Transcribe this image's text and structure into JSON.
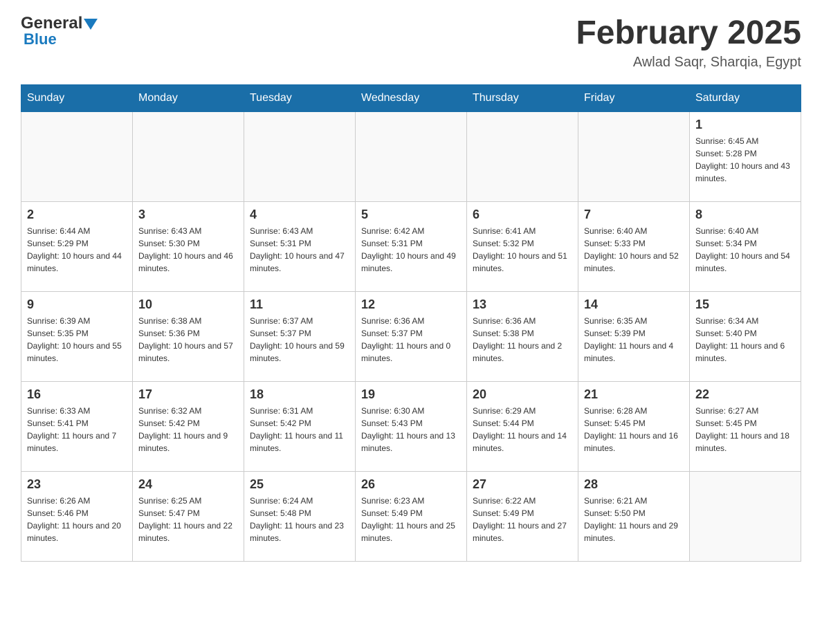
{
  "header": {
    "logo": {
      "general": "General",
      "blue": "Blue"
    },
    "title": "February 2025",
    "location": "Awlad Saqr, Sharqia, Egypt"
  },
  "weekdays": [
    "Sunday",
    "Monday",
    "Tuesday",
    "Wednesday",
    "Thursday",
    "Friday",
    "Saturday"
  ],
  "weeks": [
    [
      {
        "day": "",
        "sunrise": "",
        "sunset": "",
        "daylight": ""
      },
      {
        "day": "",
        "sunrise": "",
        "sunset": "",
        "daylight": ""
      },
      {
        "day": "",
        "sunrise": "",
        "sunset": "",
        "daylight": ""
      },
      {
        "day": "",
        "sunrise": "",
        "sunset": "",
        "daylight": ""
      },
      {
        "day": "",
        "sunrise": "",
        "sunset": "",
        "daylight": ""
      },
      {
        "day": "",
        "sunrise": "",
        "sunset": "",
        "daylight": ""
      },
      {
        "day": "1",
        "sunrise": "Sunrise: 6:45 AM",
        "sunset": "Sunset: 5:28 PM",
        "daylight": "Daylight: 10 hours and 43 minutes."
      }
    ],
    [
      {
        "day": "2",
        "sunrise": "Sunrise: 6:44 AM",
        "sunset": "Sunset: 5:29 PM",
        "daylight": "Daylight: 10 hours and 44 minutes."
      },
      {
        "day": "3",
        "sunrise": "Sunrise: 6:43 AM",
        "sunset": "Sunset: 5:30 PM",
        "daylight": "Daylight: 10 hours and 46 minutes."
      },
      {
        "day": "4",
        "sunrise": "Sunrise: 6:43 AM",
        "sunset": "Sunset: 5:31 PM",
        "daylight": "Daylight: 10 hours and 47 minutes."
      },
      {
        "day": "5",
        "sunrise": "Sunrise: 6:42 AM",
        "sunset": "Sunset: 5:31 PM",
        "daylight": "Daylight: 10 hours and 49 minutes."
      },
      {
        "day": "6",
        "sunrise": "Sunrise: 6:41 AM",
        "sunset": "Sunset: 5:32 PM",
        "daylight": "Daylight: 10 hours and 51 minutes."
      },
      {
        "day": "7",
        "sunrise": "Sunrise: 6:40 AM",
        "sunset": "Sunset: 5:33 PM",
        "daylight": "Daylight: 10 hours and 52 minutes."
      },
      {
        "day": "8",
        "sunrise": "Sunrise: 6:40 AM",
        "sunset": "Sunset: 5:34 PM",
        "daylight": "Daylight: 10 hours and 54 minutes."
      }
    ],
    [
      {
        "day": "9",
        "sunrise": "Sunrise: 6:39 AM",
        "sunset": "Sunset: 5:35 PM",
        "daylight": "Daylight: 10 hours and 55 minutes."
      },
      {
        "day": "10",
        "sunrise": "Sunrise: 6:38 AM",
        "sunset": "Sunset: 5:36 PM",
        "daylight": "Daylight: 10 hours and 57 minutes."
      },
      {
        "day": "11",
        "sunrise": "Sunrise: 6:37 AM",
        "sunset": "Sunset: 5:37 PM",
        "daylight": "Daylight: 10 hours and 59 minutes."
      },
      {
        "day": "12",
        "sunrise": "Sunrise: 6:36 AM",
        "sunset": "Sunset: 5:37 PM",
        "daylight": "Daylight: 11 hours and 0 minutes."
      },
      {
        "day": "13",
        "sunrise": "Sunrise: 6:36 AM",
        "sunset": "Sunset: 5:38 PM",
        "daylight": "Daylight: 11 hours and 2 minutes."
      },
      {
        "day": "14",
        "sunrise": "Sunrise: 6:35 AM",
        "sunset": "Sunset: 5:39 PM",
        "daylight": "Daylight: 11 hours and 4 minutes."
      },
      {
        "day": "15",
        "sunrise": "Sunrise: 6:34 AM",
        "sunset": "Sunset: 5:40 PM",
        "daylight": "Daylight: 11 hours and 6 minutes."
      }
    ],
    [
      {
        "day": "16",
        "sunrise": "Sunrise: 6:33 AM",
        "sunset": "Sunset: 5:41 PM",
        "daylight": "Daylight: 11 hours and 7 minutes."
      },
      {
        "day": "17",
        "sunrise": "Sunrise: 6:32 AM",
        "sunset": "Sunset: 5:42 PM",
        "daylight": "Daylight: 11 hours and 9 minutes."
      },
      {
        "day": "18",
        "sunrise": "Sunrise: 6:31 AM",
        "sunset": "Sunset: 5:42 PM",
        "daylight": "Daylight: 11 hours and 11 minutes."
      },
      {
        "day": "19",
        "sunrise": "Sunrise: 6:30 AM",
        "sunset": "Sunset: 5:43 PM",
        "daylight": "Daylight: 11 hours and 13 minutes."
      },
      {
        "day": "20",
        "sunrise": "Sunrise: 6:29 AM",
        "sunset": "Sunset: 5:44 PM",
        "daylight": "Daylight: 11 hours and 14 minutes."
      },
      {
        "day": "21",
        "sunrise": "Sunrise: 6:28 AM",
        "sunset": "Sunset: 5:45 PM",
        "daylight": "Daylight: 11 hours and 16 minutes."
      },
      {
        "day": "22",
        "sunrise": "Sunrise: 6:27 AM",
        "sunset": "Sunset: 5:45 PM",
        "daylight": "Daylight: 11 hours and 18 minutes."
      }
    ],
    [
      {
        "day": "23",
        "sunrise": "Sunrise: 6:26 AM",
        "sunset": "Sunset: 5:46 PM",
        "daylight": "Daylight: 11 hours and 20 minutes."
      },
      {
        "day": "24",
        "sunrise": "Sunrise: 6:25 AM",
        "sunset": "Sunset: 5:47 PM",
        "daylight": "Daylight: 11 hours and 22 minutes."
      },
      {
        "day": "25",
        "sunrise": "Sunrise: 6:24 AM",
        "sunset": "Sunset: 5:48 PM",
        "daylight": "Daylight: 11 hours and 23 minutes."
      },
      {
        "day": "26",
        "sunrise": "Sunrise: 6:23 AM",
        "sunset": "Sunset: 5:49 PM",
        "daylight": "Daylight: 11 hours and 25 minutes."
      },
      {
        "day": "27",
        "sunrise": "Sunrise: 6:22 AM",
        "sunset": "Sunset: 5:49 PM",
        "daylight": "Daylight: 11 hours and 27 minutes."
      },
      {
        "day": "28",
        "sunrise": "Sunrise: 6:21 AM",
        "sunset": "Sunset: 5:50 PM",
        "daylight": "Daylight: 11 hours and 29 minutes."
      },
      {
        "day": "",
        "sunrise": "",
        "sunset": "",
        "daylight": ""
      }
    ]
  ]
}
